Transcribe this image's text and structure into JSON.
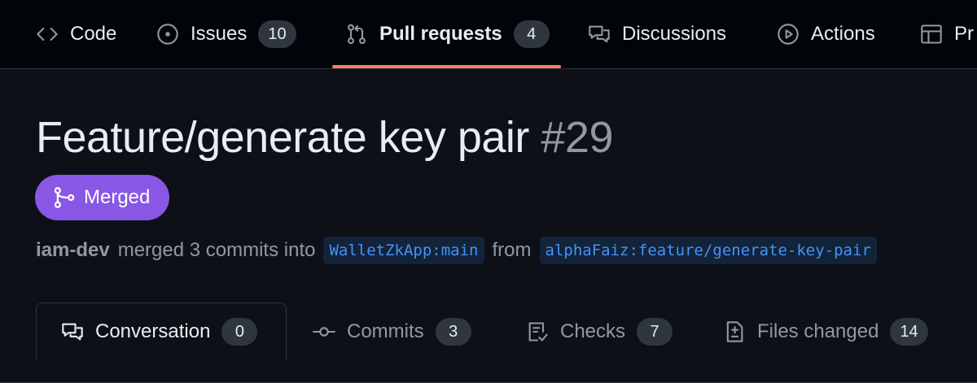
{
  "repo_nav": {
    "items": [
      {
        "label": "Code",
        "icon": "code-icon"
      },
      {
        "label": "Issues",
        "count": "10",
        "icon": "issue-opened-icon"
      },
      {
        "label": "Pull requests",
        "count": "4",
        "icon": "git-pull-request-icon",
        "selected": true
      },
      {
        "label": "Discussions",
        "icon": "comment-discussion-icon"
      },
      {
        "label": "Actions",
        "icon": "play-icon"
      },
      {
        "label": "Pr",
        "icon": "table-icon"
      }
    ]
  },
  "pr": {
    "title": "Feature/generate key pair",
    "number": "#29",
    "state": "Merged",
    "author": "iam-dev",
    "merged_text": "merged 3 commits into",
    "base_branch": "WalletZkApp:main",
    "from_text": "from",
    "head_branch": "alphaFaiz:feature/generate-key-pair"
  },
  "tabs": [
    {
      "label": "Conversation",
      "count": "0",
      "icon": "comment-discussion-icon",
      "active": true
    },
    {
      "label": "Commits",
      "count": "3",
      "icon": "git-commit-icon"
    },
    {
      "label": "Checks",
      "count": "7",
      "icon": "checklist-icon"
    },
    {
      "label": "Files changed",
      "count": "14",
      "icon": "file-diff-icon"
    }
  ],
  "colors": {
    "background": "#0d1117",
    "header_background": "#010409",
    "merged_purple": "#8957e5",
    "selected_underline": "#f78166",
    "branch_link": "#4493f8"
  }
}
